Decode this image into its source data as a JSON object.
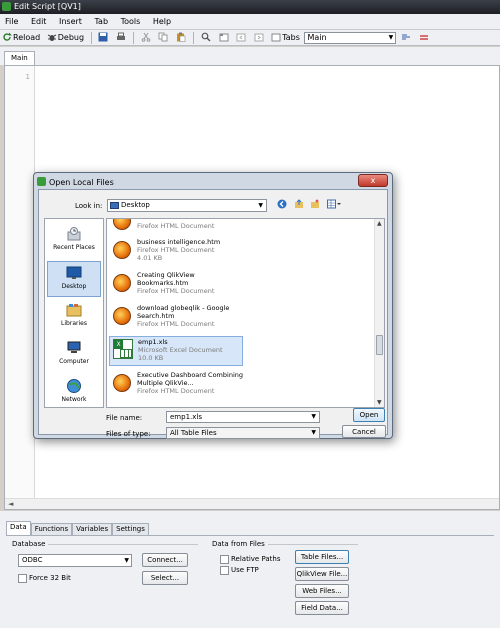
{
  "window": {
    "title": "Edit Script [QV1]"
  },
  "menu": [
    "File",
    "Edit",
    "Insert",
    "Tab",
    "Tools",
    "Help"
  ],
  "toolbar": {
    "reload": "Reload",
    "debug": "Debug",
    "tabs_label": "Tabs",
    "tabs_value": "Main"
  },
  "doc_tabs": [
    "Main"
  ],
  "editor": {
    "line_number": "1"
  },
  "bottom": {
    "tabs": [
      "Data",
      "Functions",
      "Variables",
      "Settings"
    ],
    "database": {
      "label": "Database",
      "combo_value": "ODBC",
      "connect": "Connect...",
      "select": "Select...",
      "force32": "Force 32 Bit"
    },
    "files": {
      "label": "Data from Files",
      "relative_paths": "Relative Paths",
      "use_ftp": "Use FTP",
      "table_files": "Table Files...",
      "qlikview_file": "QlikView File...",
      "web_files": "Web Files...",
      "field_data": "Field Data..."
    }
  },
  "dialog": {
    "title": "Open Local Files",
    "close": "x",
    "look_in_label": "Look in:",
    "look_in_value": "Desktop",
    "places": [
      "Recent Places",
      "Desktop",
      "Libraries",
      "Computer",
      "Network"
    ],
    "files": [
      {
        "name": "",
        "type": "Firefox HTML Document",
        "size": ""
      },
      {
        "name": "business intelligence.htm",
        "type": "Firefox HTML Document",
        "size": "4.01 KB"
      },
      {
        "name": "Creating QlikView Bookmarks.htm",
        "type": "Firefox HTML Document",
        "size": ""
      },
      {
        "name": "download globeqlik - Google Search.htm",
        "type": "Firefox HTML Document",
        "size": ""
      },
      {
        "name": "emp1.xls",
        "type": "Microsoft Excel Document",
        "size": "10.0 KB"
      },
      {
        "name": "Executive Dashboard Combining Multiple QlikVie...",
        "type": "Firefox HTML Document",
        "size": ""
      }
    ],
    "file_name_label": "File name:",
    "file_name_value": "emp1.xls",
    "files_of_type_label": "Files of type:",
    "files_of_type_value": "All Table Files",
    "open": "Open",
    "cancel": "Cancel"
  }
}
